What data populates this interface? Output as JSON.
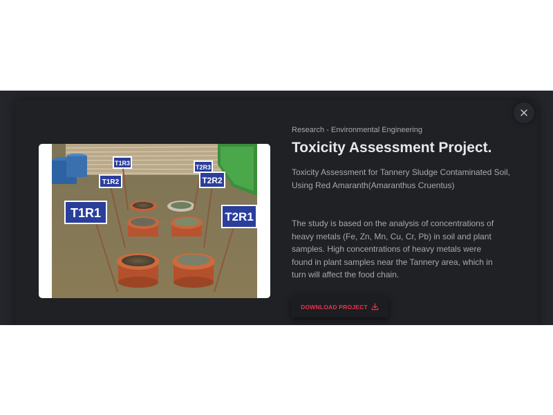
{
  "modal": {
    "category": "Research - Environmental Engineering",
    "title": "Toxicity Assessment Project.",
    "subtitle": "Toxicity Assessment for Tannery Sludge Contaminated Soil, Using Red Amaranth(Amaranthus Cruentus)",
    "description": "The study is based on the analysis of concentrations of heavy metals (Fe, Zn, Mn, Cu, Cr, Pb) in soil and plant samples. High concentrations of heavy metals were found in plant samples near the Tannery area, which in turn will affect the food chain.",
    "download_label": "DOWNLOAD PROJECT",
    "close_icon": "close-icon",
    "download_icon": "download-icon",
    "accent_color": "#f0314f"
  },
  "photo": {
    "sign_labels": [
      "T1R3",
      "T1R2",
      "T2R3",
      "T2R2",
      "T1R1",
      "T2R1"
    ]
  }
}
